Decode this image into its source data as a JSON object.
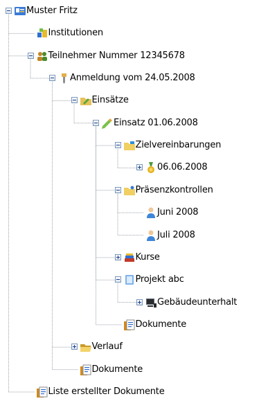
{
  "tree": {
    "nodes": [
      {
        "label": "Muster Fritz",
        "icon": "person-card-icon",
        "expander": "minus"
      },
      {
        "label": "Institutionen",
        "icon": "institution-blocks-icon",
        "expander": null
      },
      {
        "label": "Teilnehmer Nummer 12345678",
        "icon": "participants-group-icon",
        "expander": "minus"
      },
      {
        "label": "Anmeldung vom 24.05.2008",
        "icon": "registration-pin-icon",
        "expander": "minus"
      },
      {
        "label": "Einsätze",
        "icon": "assignments-folder-icon",
        "expander": "minus"
      },
      {
        "label": "Einsatz 01.06.2008",
        "icon": "assignment-pencil-icon",
        "expander": "minus"
      },
      {
        "label": "Zielvereinbarungen",
        "icon": "goals-folder-icon",
        "expander": "minus"
      },
      {
        "label": "06.06.2008",
        "icon": "medal-icon",
        "expander": "plus"
      },
      {
        "label": "Präsenzkontrollen",
        "icon": "attendance-folder-icon",
        "expander": "minus"
      },
      {
        "label": "Juni 2008",
        "icon": "person-icon",
        "expander": null
      },
      {
        "label": "Juli 2008",
        "icon": "person-icon",
        "expander": null
      },
      {
        "label": "Kurse",
        "icon": "books-icon",
        "expander": "plus"
      },
      {
        "label": "Projekt abc",
        "icon": "project-icon",
        "expander": "minus"
      },
      {
        "label": "Gebäudeunterhalt",
        "icon": "computer-icon",
        "expander": "plus"
      },
      {
        "label": "Dokumente",
        "icon": "document-icon",
        "expander": null
      },
      {
        "label": "Verlauf",
        "icon": "open-folder-icon",
        "expander": "plus"
      },
      {
        "label": "Dokumente",
        "icon": "document-icon",
        "expander": null
      },
      {
        "label": "Liste erstellter Dokumente",
        "icon": "document-icon",
        "expander": null
      }
    ]
  }
}
